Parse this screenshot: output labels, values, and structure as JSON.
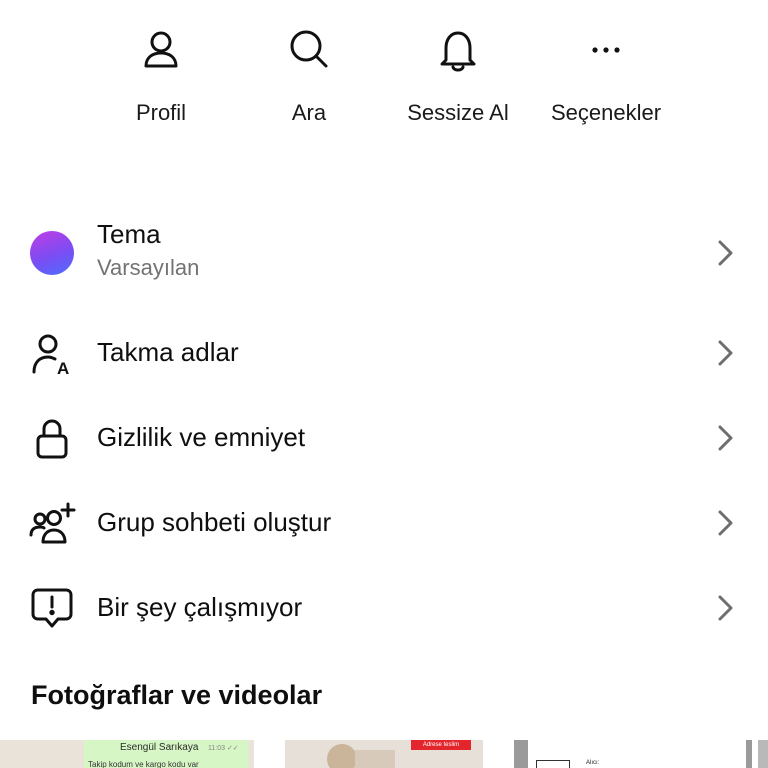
{
  "actions": [
    {
      "label": "Profil",
      "icon": "person-icon"
    },
    {
      "label": "Ara",
      "icon": "search-icon"
    },
    {
      "label": "Sessize Al",
      "icon": "bell-icon"
    },
    {
      "label": "Seçenekler",
      "icon": "more-options-icon"
    }
  ],
  "settings": {
    "theme": {
      "title": "Tema",
      "subtitle": "Varsayılan",
      "icon": "theme-color-dot"
    },
    "items": [
      {
        "label": "Takma adlar",
        "icon": "nickname-icon"
      },
      {
        "label": "Gizlilik ve emniyet",
        "icon": "lock-icon"
      },
      {
        "label": "Grup sohbeti oluştur",
        "icon": "add-group-icon"
      },
      {
        "label": "Bir şey çalışmıyor",
        "icon": "report-problem-icon"
      }
    ]
  },
  "media": {
    "title": "Fotoğraflar ve videolar",
    "thumbs": [
      {
        "name": "Esengül Sarıkaya",
        "time": "11:03 ✓✓",
        "text": "Takip kodum ve kargo kodu var"
      },
      {
        "tag": "Adrese teslim"
      },
      {
        "text": "Alıcı:"
      },
      {}
    ]
  },
  "colors": {
    "text": "#0f0f0f",
    "secondary_text": "#737373",
    "chevron": "#6e6e6e",
    "theme_gradient": [
      "#c23de6",
      "#7a4df2",
      "#4e6cff"
    ]
  }
}
